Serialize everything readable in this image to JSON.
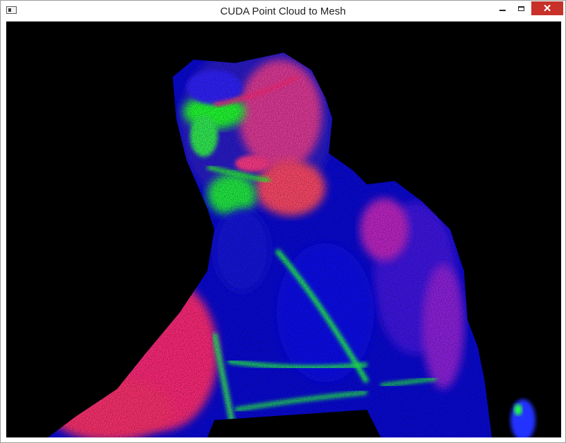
{
  "window": {
    "title": "CUDA Point Cloud to Mesh",
    "icon": "app-window-icon",
    "controls": {
      "minimize_icon": "minimize-icon",
      "maximize_icon": "maximize-icon",
      "close_icon": "close-icon"
    }
  },
  "viewport": {
    "background": "#000000",
    "render_colors": [
      "#1a1aff",
      "#ff2a7a",
      "#22ff33",
      "#7a2cff"
    ]
  }
}
